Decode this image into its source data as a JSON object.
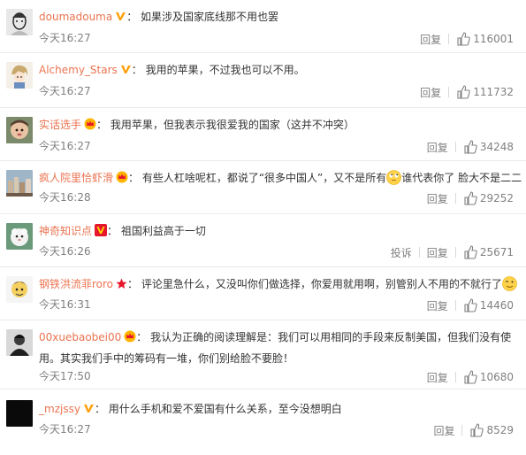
{
  "comments": [
    {
      "user": "doumadouma",
      "badge": "v-yellow",
      "text": "如果涉及国家底线那不用也罢",
      "time": "今天16:27",
      "reply_label": "回复",
      "likes": "116001",
      "avatar": "sketch-face"
    },
    {
      "user": "Alchemy_Stars",
      "badge": "v-yellow",
      "text": "我用的苹果，不过我也可以不用。",
      "time": "今天16:27",
      "reply_label": "回复",
      "likes": "111732",
      "avatar": "anime-character"
    },
    {
      "user": "实话选手",
      "badge": "crown",
      "text": "我用苹果，但我表示我很爱我的国家（这并不冲突）",
      "time": "今天16:27",
      "reply_label": "回复",
      "likes": "34248",
      "avatar": "baby-photo"
    },
    {
      "user": "疯人院里恰虾滑",
      "badge": "crown",
      "text": "有些人杠啥呢杠，都说了“很多中国人”，又不是所有",
      "text_after_emoji": "谁代表你了 脸大不是二二",
      "emoji": "rolling-eyes-emoji",
      "time": "今天16:28",
      "reply_label": "回复",
      "likes": "29252",
      "avatar": "city-photo"
    },
    {
      "user": "神奇知识点",
      "badge": "v-red",
      "text": "祖国利益高于一切",
      "time": "今天16:26",
      "report_label": "投诉",
      "reply_label": "回复",
      "likes": "25671",
      "avatar": "white-fluffy-creature"
    },
    {
      "user": "钢铁洪流菲roro",
      "badge": "star-red",
      "text": "评论里急什么，又没叫你们做选择，你爱用就用啊，别管别人不用的不就行了",
      "emoji": "winking-emoji",
      "time": "今天16:31",
      "reply_label": "回复",
      "likes": "14460",
      "avatar": "cartoon-character"
    },
    {
      "user": "00xuebaobei00",
      "badge": "crown",
      "text": "我认为正确的阅读理解是：我们可以用相同的手段来反制美国，但我们没有使用。其实我们手中的筹码有一堆，你们别给脸不要脸！",
      "time": "今天17:50",
      "reply_label": "回复",
      "likes": "10680",
      "avatar": "dark-portrait"
    },
    {
      "user": "_mzjssy",
      "badge": "v-yellow",
      "text": "用什么手机和爱不爱国有什么关系，至今没想明白",
      "time": "今天16:27",
      "reply_label": "回复",
      "likes": "8529",
      "avatar": "black-square"
    }
  ],
  "colors": {
    "username": "#eb7350",
    "text": "#333333",
    "meta": "#808080",
    "divider": "#eaeaea",
    "badge_yellow": "#ffa00a",
    "badge_red": "#e6162d"
  }
}
